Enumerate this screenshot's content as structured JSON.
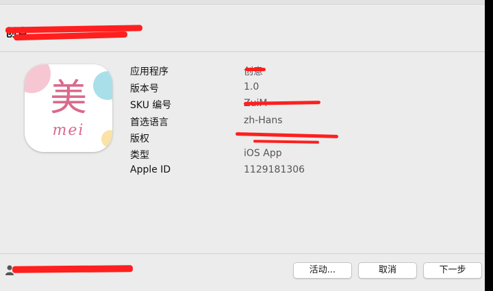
{
  "header": {
    "title": "创意"
  },
  "app_icon": {
    "char": "美",
    "word": "mei",
    "colors": {
      "accent": "#d96a8c",
      "pink": "#f6c7d3",
      "blue": "#a9dfe9",
      "yellow": "#fbe2a6"
    }
  },
  "info": {
    "rows": [
      {
        "label": "应用程序",
        "value": "创意"
      },
      {
        "label": "版本号",
        "value": "1.0"
      },
      {
        "label": "SKU 编号",
        "value": "ZuiM"
      },
      {
        "label": "首选语言",
        "value": "zh-Hans"
      },
      {
        "label": "版权",
        "value": ""
      },
      {
        "label": "类型",
        "value": "iOS App"
      },
      {
        "label": "Apple ID",
        "value": "1129181306"
      }
    ]
  },
  "footer": {
    "account": "",
    "buttons": {
      "activity": "活动...",
      "cancel": "取消",
      "next": "下一步"
    }
  },
  "colors": {
    "redaction": "#ff1f1f",
    "window_bg": "#ececec"
  }
}
